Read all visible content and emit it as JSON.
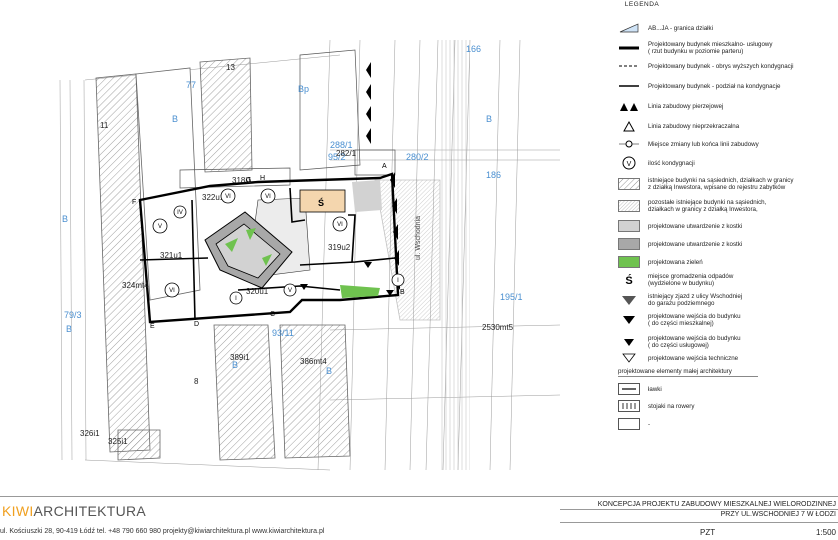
{
  "map": {
    "parcels": {
      "n77": "77",
      "n13": "13",
      "n166": "166",
      "n186": "186",
      "n79_3": "79/3",
      "bp1": "Bp",
      "b_left1": "B",
      "b_left2": "B",
      "b_right": "B",
      "b_bottom1": "B",
      "b_bottom2": "B",
      "b_bottom3": "B",
      "p288_1": "288/1",
      "p282_1": "282/1",
      "p95_2": "95/2",
      "p280_2": "280/2",
      "p195_1": "195/1",
      "p93_11": "93/11",
      "p318i1": "318i1",
      "p322u1": "322u1",
      "p321u1": "321u1",
      "p319u2": "319u2",
      "p320u1": "320u1",
      "p324mt4": "324mt4",
      "p389i1": "389i1",
      "p386mt4": "386mt4",
      "p2530mt5": "2530mt5",
      "p326i1": "326i1",
      "p325i1": "325i1",
      "p11": "11",
      "p8": "8"
    },
    "points": {
      "a": "A",
      "b": "B",
      "c": "C",
      "d": "D",
      "e": "E",
      "f": "F",
      "g": "G",
      "h": "H"
    },
    "storeys": {
      "iv": "IV",
      "vi": "VI",
      "i": "I",
      "v": "V"
    },
    "waste_symbol": "Ś",
    "street": "ul. Wschodnia"
  },
  "legend": {
    "title": "LEGENDA",
    "items": [
      "AB...JA - granica działki",
      "Projektowany budynek mieszkalno- usługowy\n( rzut budynku w poziomie parteru)",
      "Projektowany budynek - obrys wyższych kondygnacji",
      "Projektowany budynek - podział na kondygnacje",
      "Linia zabudowy pierzejowej",
      "Linia zabudowy nieprzekraczalna",
      "Miejsce zmiany lub końca linii zabudowy",
      "ilość kondygnacji",
      "istniejące budynki na sąsiednich, działkach w granicy\nz działką Inwestora, wpisane do rejestru zabytków",
      "pozostałe istniejące budynki na sąsiednich,\ndziałkach w granicy z działką Inwestora,",
      "projektowane utwardzenie z kostki",
      "projektowane utwardzenie z kostki",
      "projektowana zieleń",
      "miejsce gromadzenia odpadów\n(wydzielone w budynku)",
      "istniejący zjazd z ulicy Wschodniej\ndo garażu podziemnego",
      "projektowane wejścia do budynku\n( do części mieszkalnej)",
      "projektowane wejścia do budynku\n( do części usługowej)",
      "projektowane wejścia techniczne"
    ],
    "small_arch_heading": "projektowane elementy małej architektury",
    "small_arch_items": [
      "ławki",
      "stojaki na rowery",
      "-"
    ]
  },
  "footer": {
    "logo_kiwi": "KIWI",
    "logo_rest": "ARCHITEKTURA",
    "address": "ul. Kościuszki 28, 90-419 Łódź  tel. +48 790 660 980  projekty@kiwiarchitektura.pl  www.kiwiarchitektura.pl",
    "title_line1": "KONCEPCJA PROJEKTU ZABUDOWY MIESZKALNEJ WIELORODZINNEJ",
    "title_line2": "PRZY UL.WSCHODNIEJ 7 W ŁODZI",
    "stage": "PZT",
    "scale": "1:500"
  },
  "colors": {
    "hatch": "#777777",
    "parcel_num": "#4a8fd0",
    "green": "#6fc24f",
    "paving_light": "#d2d2d2",
    "paving_dark": "#a8a8a8",
    "logo_accent": "#f0a020"
  }
}
